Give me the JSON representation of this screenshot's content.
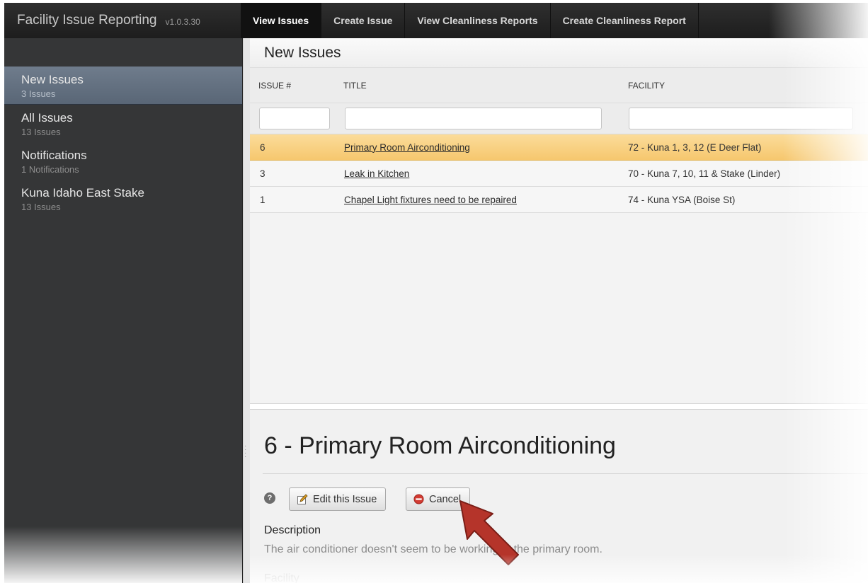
{
  "app": {
    "title": "Facility Issue Reporting",
    "version": "v1.0.3.30"
  },
  "nav": [
    {
      "label": "View Issues",
      "active": true
    },
    {
      "label": "Create Issue",
      "active": false
    },
    {
      "label": "View Cleanliness Reports",
      "active": false
    },
    {
      "label": "Create Cleanliness Report",
      "active": false
    }
  ],
  "sidebar": {
    "items": [
      {
        "label": "New Issues",
        "count": "3 Issues",
        "active": true
      },
      {
        "label": "All Issues",
        "count": "13 Issues",
        "active": false
      },
      {
        "label": "Notifications",
        "count": "1 Notifications",
        "active": false
      },
      {
        "label": "Kuna Idaho East Stake",
        "count": "13 Issues",
        "active": false
      }
    ]
  },
  "list": {
    "title": "New Issues",
    "columns": {
      "issue": "ISSUE #",
      "title": "TITLE",
      "facility": "FACILITY"
    },
    "filters": {
      "issue": "",
      "title": "",
      "facility": ""
    },
    "rows": [
      {
        "issue": "6",
        "title": "Primary Room Airconditioning",
        "facility": "72 - Kuna 1, 3, 12 (E Deer Flat)",
        "selected": true
      },
      {
        "issue": "3",
        "title": "Leak in Kitchen",
        "facility": "70 - Kuna 7, 10, 11 & Stake (Linder)",
        "selected": false
      },
      {
        "issue": "1",
        "title": "Chapel Light fixtures need to be repaired",
        "facility": "74 - Kuna YSA (Boise St)",
        "selected": false
      }
    ]
  },
  "detail": {
    "title": "6 - Primary Room Airconditioning",
    "help_icon": "?",
    "edit_label": "Edit this Issue",
    "cancel_label": "Cancel",
    "description_label": "Description",
    "description_text": "The air conditioner doesn't seem to be working in the primary room.",
    "facility_label": "Facility"
  },
  "colors": {
    "selected_row": "#f6c76e",
    "sidebar_active": "#6f7c8c",
    "arrow": "#b5342a"
  },
  "icons": {
    "edit": "edit-icon",
    "cancel": "cancel-circle-icon",
    "help": "help-icon",
    "pointer": "pointer-arrow-icon"
  }
}
